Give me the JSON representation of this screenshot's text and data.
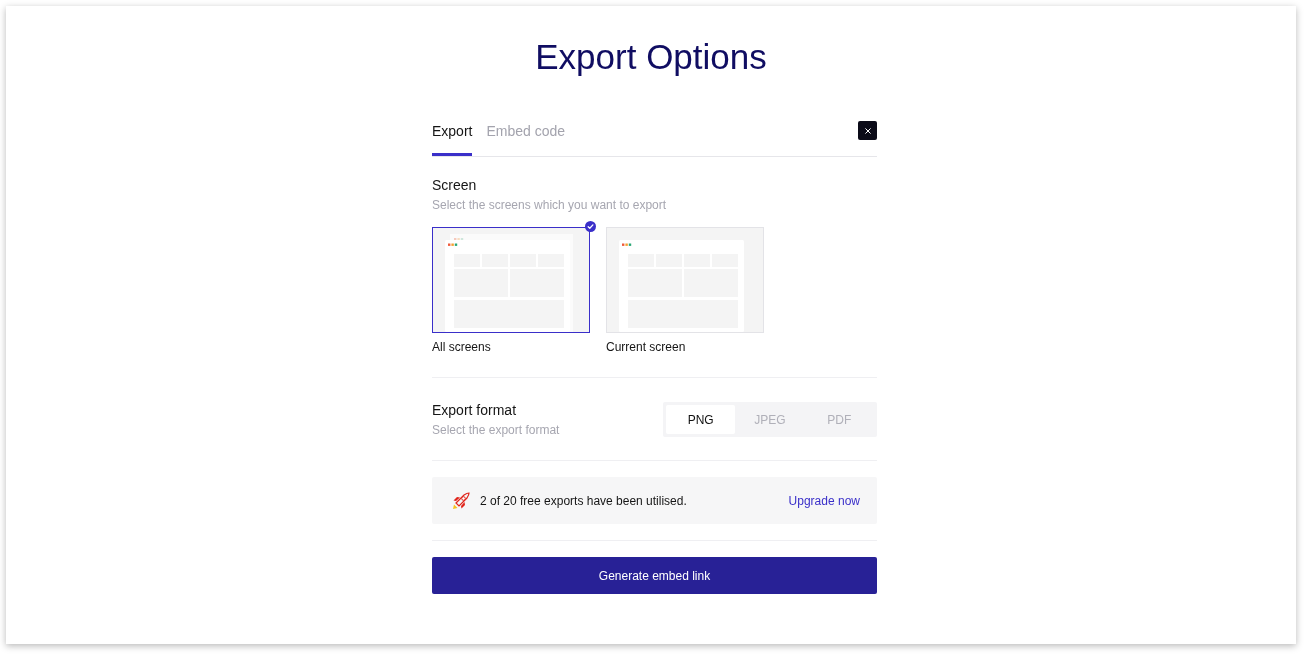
{
  "title": "Export Options",
  "tabs": [
    {
      "label": "Export",
      "selected": true
    },
    {
      "label": "Embed code",
      "selected": false
    }
  ],
  "screen_section": {
    "heading": "Screen",
    "description": "Select the screens which you want to export",
    "options": [
      {
        "label": "All screens",
        "kind": "stack",
        "selected": true
      },
      {
        "label": "Current screen",
        "kind": "single",
        "selected": false
      }
    ]
  },
  "format_section": {
    "heading": "Export format",
    "description": "Select the export format",
    "formats": [
      {
        "label": "PNG",
        "selected": true
      },
      {
        "label": "JPEG",
        "selected": false
      },
      {
        "label": "PDF",
        "selected": false
      }
    ]
  },
  "usage_banner": {
    "message": "2 of 20 free exports have been utilised.",
    "link": "Upgrade now"
  },
  "primary_button": {
    "label": "Generate embed link"
  }
}
